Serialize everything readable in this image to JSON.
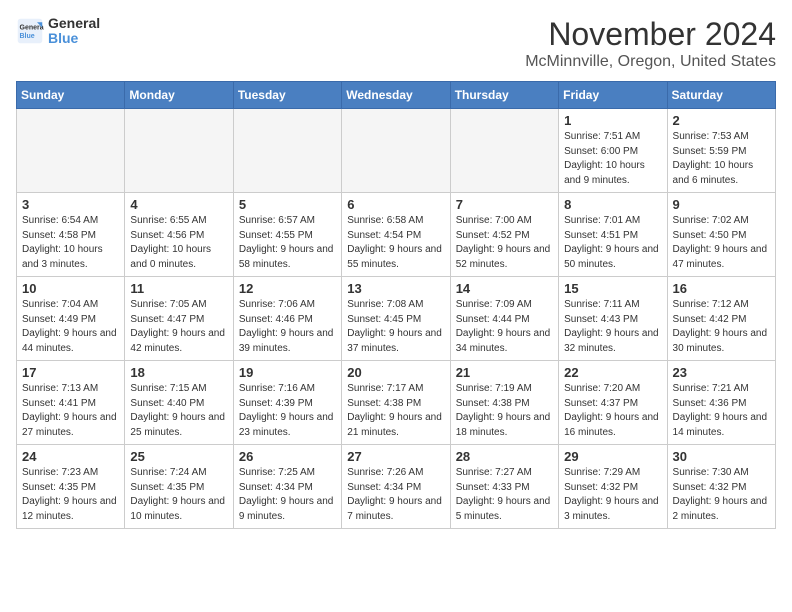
{
  "header": {
    "logo_general": "General",
    "logo_blue": "Blue",
    "month_year": "November 2024",
    "location": "McMinnville, Oregon, United States"
  },
  "calendar": {
    "days_of_week": [
      "Sunday",
      "Monday",
      "Tuesday",
      "Wednesday",
      "Thursday",
      "Friday",
      "Saturday"
    ],
    "weeks": [
      [
        {
          "day": "",
          "info": "",
          "empty": true
        },
        {
          "day": "",
          "info": "",
          "empty": true
        },
        {
          "day": "",
          "info": "",
          "empty": true
        },
        {
          "day": "",
          "info": "",
          "empty": true
        },
        {
          "day": "",
          "info": "",
          "empty": true
        },
        {
          "day": "1",
          "info": "Sunrise: 7:51 AM\nSunset: 6:00 PM\nDaylight: 10 hours\nand 9 minutes.",
          "empty": false
        },
        {
          "day": "2",
          "info": "Sunrise: 7:53 AM\nSunset: 5:59 PM\nDaylight: 10 hours\nand 6 minutes.",
          "empty": false
        }
      ],
      [
        {
          "day": "3",
          "info": "Sunrise: 6:54 AM\nSunset: 4:58 PM\nDaylight: 10 hours\nand 3 minutes.",
          "empty": false
        },
        {
          "day": "4",
          "info": "Sunrise: 6:55 AM\nSunset: 4:56 PM\nDaylight: 10 hours\nand 0 minutes.",
          "empty": false
        },
        {
          "day": "5",
          "info": "Sunrise: 6:57 AM\nSunset: 4:55 PM\nDaylight: 9 hours\nand 58 minutes.",
          "empty": false
        },
        {
          "day": "6",
          "info": "Sunrise: 6:58 AM\nSunset: 4:54 PM\nDaylight: 9 hours\nand 55 minutes.",
          "empty": false
        },
        {
          "day": "7",
          "info": "Sunrise: 7:00 AM\nSunset: 4:52 PM\nDaylight: 9 hours\nand 52 minutes.",
          "empty": false
        },
        {
          "day": "8",
          "info": "Sunrise: 7:01 AM\nSunset: 4:51 PM\nDaylight: 9 hours\nand 50 minutes.",
          "empty": false
        },
        {
          "day": "9",
          "info": "Sunrise: 7:02 AM\nSunset: 4:50 PM\nDaylight: 9 hours\nand 47 minutes.",
          "empty": false
        }
      ],
      [
        {
          "day": "10",
          "info": "Sunrise: 7:04 AM\nSunset: 4:49 PM\nDaylight: 9 hours\nand 44 minutes.",
          "empty": false
        },
        {
          "day": "11",
          "info": "Sunrise: 7:05 AM\nSunset: 4:47 PM\nDaylight: 9 hours\nand 42 minutes.",
          "empty": false
        },
        {
          "day": "12",
          "info": "Sunrise: 7:06 AM\nSunset: 4:46 PM\nDaylight: 9 hours\nand 39 minutes.",
          "empty": false
        },
        {
          "day": "13",
          "info": "Sunrise: 7:08 AM\nSunset: 4:45 PM\nDaylight: 9 hours\nand 37 minutes.",
          "empty": false
        },
        {
          "day": "14",
          "info": "Sunrise: 7:09 AM\nSunset: 4:44 PM\nDaylight: 9 hours\nand 34 minutes.",
          "empty": false
        },
        {
          "day": "15",
          "info": "Sunrise: 7:11 AM\nSunset: 4:43 PM\nDaylight: 9 hours\nand 32 minutes.",
          "empty": false
        },
        {
          "day": "16",
          "info": "Sunrise: 7:12 AM\nSunset: 4:42 PM\nDaylight: 9 hours\nand 30 minutes.",
          "empty": false
        }
      ],
      [
        {
          "day": "17",
          "info": "Sunrise: 7:13 AM\nSunset: 4:41 PM\nDaylight: 9 hours\nand 27 minutes.",
          "empty": false
        },
        {
          "day": "18",
          "info": "Sunrise: 7:15 AM\nSunset: 4:40 PM\nDaylight: 9 hours\nand 25 minutes.",
          "empty": false
        },
        {
          "day": "19",
          "info": "Sunrise: 7:16 AM\nSunset: 4:39 PM\nDaylight: 9 hours\nand 23 minutes.",
          "empty": false
        },
        {
          "day": "20",
          "info": "Sunrise: 7:17 AM\nSunset: 4:38 PM\nDaylight: 9 hours\nand 21 minutes.",
          "empty": false
        },
        {
          "day": "21",
          "info": "Sunrise: 7:19 AM\nSunset: 4:38 PM\nDaylight: 9 hours\nand 18 minutes.",
          "empty": false
        },
        {
          "day": "22",
          "info": "Sunrise: 7:20 AM\nSunset: 4:37 PM\nDaylight: 9 hours\nand 16 minutes.",
          "empty": false
        },
        {
          "day": "23",
          "info": "Sunrise: 7:21 AM\nSunset: 4:36 PM\nDaylight: 9 hours\nand 14 minutes.",
          "empty": false
        }
      ],
      [
        {
          "day": "24",
          "info": "Sunrise: 7:23 AM\nSunset: 4:35 PM\nDaylight: 9 hours\nand 12 minutes.",
          "empty": false
        },
        {
          "day": "25",
          "info": "Sunrise: 7:24 AM\nSunset: 4:35 PM\nDaylight: 9 hours\nand 10 minutes.",
          "empty": false
        },
        {
          "day": "26",
          "info": "Sunrise: 7:25 AM\nSunset: 4:34 PM\nDaylight: 9 hours\nand 9 minutes.",
          "empty": false
        },
        {
          "day": "27",
          "info": "Sunrise: 7:26 AM\nSunset: 4:34 PM\nDaylight: 9 hours\nand 7 minutes.",
          "empty": false
        },
        {
          "day": "28",
          "info": "Sunrise: 7:27 AM\nSunset: 4:33 PM\nDaylight: 9 hours\nand 5 minutes.",
          "empty": false
        },
        {
          "day": "29",
          "info": "Sunrise: 7:29 AM\nSunset: 4:32 PM\nDaylight: 9 hours\nand 3 minutes.",
          "empty": false
        },
        {
          "day": "30",
          "info": "Sunrise: 7:30 AM\nSunset: 4:32 PM\nDaylight: 9 hours\nand 2 minutes.",
          "empty": false
        }
      ]
    ]
  }
}
